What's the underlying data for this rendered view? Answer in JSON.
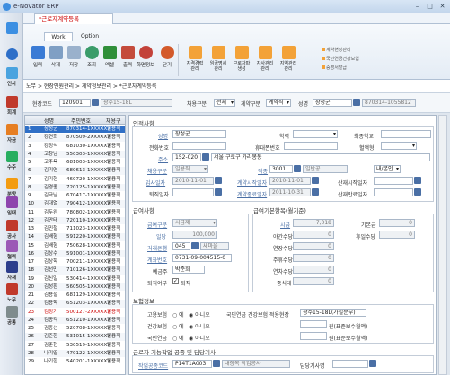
{
  "app": {
    "title": "e-Novator ERP"
  },
  "leftnav": [
    {
      "label": "",
      "name": "home"
    },
    {
      "label": "",
      "name": "favorite"
    },
    {
      "label": "인사",
      "name": "hr"
    },
    {
      "label": "회계",
      "name": "accounting"
    },
    {
      "label": "자금",
      "name": "fund"
    },
    {
      "label": "수주",
      "name": "order"
    },
    {
      "label": "분양",
      "name": "sale"
    },
    {
      "label": "임대",
      "name": "lease"
    },
    {
      "label": "공사",
      "name": "construction"
    },
    {
      "label": "협력",
      "name": "partner"
    },
    {
      "label": "자재",
      "name": "material"
    },
    {
      "label": "노무",
      "name": "labor"
    },
    {
      "label": "공통",
      "name": "common"
    }
  ],
  "doc_tab": "*근로자계약등록",
  "ribbon": {
    "tabs": [
      "Work",
      "Option"
    ],
    "buttons": [
      {
        "label": "입력",
        "color": "#3a7bd5"
      },
      {
        "label": "삭제",
        "color": "#7f9fc4"
      },
      {
        "label": "저장",
        "color": "#9ab1cc"
      },
      {
        "label": "조회",
        "color": "#3a9c6a"
      },
      {
        "label": "엑셀",
        "color": "#2f8f3a"
      },
      {
        "label": "출력",
        "color": "#c44b3c"
      },
      {
        "label": "화면정보",
        "color": "#c3423a"
      },
      {
        "label": "닫기",
        "color": "#d35a2b"
      }
    ],
    "buttons2": [
      [
        "자격경력",
        "관리"
      ],
      [
        "임금명세",
        "관리"
      ],
      [
        "근로자파",
        "생성"
      ],
      [
        "자사관리",
        "관리"
      ],
      [
        "지역관리",
        "관리"
      ]
    ],
    "links": [
      "계약현장관리",
      "국민연금건강보험",
      "증명서발급"
    ]
  },
  "breadcrumb": "노무 > 현장인원관리 > 계약정보관리 > *근로자계약등록",
  "search": {
    "site_label": "현장코드",
    "site_code": "120901",
    "site_name": "광주15-18L",
    "emp_type_label": "채용구분",
    "emp_type": "전체",
    "contract_label": "계약구분",
    "contract": "계약직",
    "name_label": "성명",
    "name": "장성군",
    "reg": "870314-1055812"
  },
  "grid": {
    "headers": [
      "성명",
      "주민번호",
      "채용구"
    ],
    "rows": [
      {
        "no": "1",
        "name": "장성군",
        "id": "870314-1XXXXXX",
        "type": "일용직",
        "sel": true
      },
      {
        "no": "2",
        "name": "강연희",
        "id": "870509-2XXXXXX",
        "type": "일용직"
      },
      {
        "no": "3",
        "name": "강정식",
        "id": "681030-1XXXXXX",
        "type": "일용직"
      },
      {
        "no": "4",
        "name": "고창남",
        "id": "550303-1XXXXXX",
        "type": "일용직"
      },
      {
        "no": "5",
        "name": "고주옥",
        "id": "681003-1XXXXXX",
        "type": "일용직"
      },
      {
        "no": "6",
        "name": "김기연",
        "id": "680613-1XXXXXX",
        "type": "일용직"
      },
      {
        "no": "7",
        "name": "김기현",
        "id": "460720-1XXXXXX",
        "type": "일용직"
      },
      {
        "no": "8",
        "name": "김경종",
        "id": "720125-1XXXXXX",
        "type": "일용직"
      },
      {
        "no": "9",
        "name": "김극남",
        "id": "670417-1XXXXXX",
        "type": "일용직"
      },
      {
        "no": "10",
        "name": "김대열",
        "id": "790412-1XXXXXX",
        "type": "일용직"
      },
      {
        "no": "11",
        "name": "김두완",
        "id": "780802-1XXXXXX",
        "type": "일용직"
      },
      {
        "no": "12",
        "name": "김만태",
        "id": "720110-1XXXXXX",
        "type": "일용직"
      },
      {
        "no": "13",
        "name": "김민철",
        "id": "711023-1XXXXXX",
        "type": "일용직"
      },
      {
        "no": "14",
        "name": "김배형",
        "id": "591220-1XXXXXX",
        "type": "일용직"
      },
      {
        "no": "15",
        "name": "김배형",
        "id": "750628-1XXXXXX",
        "type": "일용직"
      },
      {
        "no": "16",
        "name": "김상수",
        "id": "591001-1XXXXXX",
        "type": "일용직"
      },
      {
        "no": "17",
        "name": "김상학",
        "id": "700211-1XXXXXX",
        "type": "일용직"
      },
      {
        "no": "18",
        "name": "김선민",
        "id": "710126-1XXXXXX",
        "type": "일용직"
      },
      {
        "no": "19",
        "name": "김신일",
        "id": "530414-1XXXXXX",
        "type": "일용직"
      },
      {
        "no": "20",
        "name": "김성환",
        "id": "560505-1XXXXXX",
        "type": "일용직"
      },
      {
        "no": "21",
        "name": "김용철",
        "id": "681129-1XXXXXX",
        "type": "일용직"
      },
      {
        "no": "22",
        "name": "김용학",
        "id": "651203-1XXXXXX",
        "type": "일용직"
      },
      {
        "no": "23",
        "name": "김정기",
        "id": "500127-2XXXXXX",
        "type": "일용직",
        "red": true
      },
      {
        "no": "24",
        "name": "김종각",
        "id": "651210-1XXXXXX",
        "type": "일용직"
      },
      {
        "no": "25",
        "name": "김종선",
        "id": "520708-1XXXXXX",
        "type": "일용직"
      },
      {
        "no": "26",
        "name": "김준한",
        "id": "531015-1XXXXXX",
        "type": "일용직"
      },
      {
        "no": "27",
        "name": "김준현",
        "id": "530519-1XXXXXX",
        "type": "일용직"
      },
      {
        "no": "28",
        "name": "나기엽",
        "id": "470122-1XXXXXX",
        "type": "일용직"
      },
      {
        "no": "29",
        "name": "나기한",
        "id": "540201-1XXXXXX",
        "type": "일용직"
      }
    ]
  },
  "form": {
    "sec_person": "인적사항",
    "name_label": "성명",
    "name": "장성군",
    "edu_label": "학력",
    "school_label": "최종학교",
    "phone_label": "전화번호",
    "mobile_label": "휴대폰번호",
    "blood_label": "혈액형",
    "addr_label": "주소",
    "zip": "152-020",
    "addr": "서울 구로구 가리봉동",
    "emp_type_label": "채용구분",
    "emp_type": "일용직",
    "job_label": "직종",
    "job_code": "3001",
    "job_name": "일반공",
    "job_sel": "내/본인",
    "hire_label": "입사일자",
    "hire": "2010-11-01",
    "start_label": "계약시작일자",
    "start": "2010-11-01",
    "insure_start_label": "산재시작일자",
    "retire_label": "퇴직일자",
    "end_label": "계약종료일자",
    "end": "2011-10-31",
    "insure_end_label": "산재만료일자",
    "sec_pay": "급여사항",
    "pay_type_label": "급여구분",
    "pay_type": "시급제",
    "daily_label": "일당",
    "daily": "100,000",
    "bank_label": "거래은행",
    "bank_code": "045",
    "bank_name": "새마을",
    "acct_label": "계좌번호",
    "acct": "0731-09-004515-0",
    "holder_label": "예금주",
    "holder": "박준희",
    "retire_yn_label": "퇴직여부",
    "retire_yn": "퇴직",
    "sec_calc": "급여기본항목(월기준)",
    "hourly_label": "시급",
    "hourly": "7,018",
    "basic_label": "기본급",
    "basic": "0",
    "night_label": "야간수당",
    "night": "0",
    "holiday_label": "휴일수당",
    "holiday": "0",
    "extend_label": "연장수당",
    "extend": "0",
    "weekly_label": "주휴수당",
    "weekly": "0",
    "annual_label": "연차수당",
    "annual": "0",
    "other_label": "중식대",
    "other": "0",
    "sec_ins": "보험정보",
    "emp_ins_label": "고용보험",
    "yes": "예",
    "no": "아니오",
    "ins_site_label": "국민연금 건강보험 적용현장",
    "ins_site": "광주15-18L(가설분부)",
    "health_label": "건강보험",
    "health_note": "원(표준보수월액)",
    "pension_label": "국민연금",
    "pension_note": "원(표준보수월액)",
    "sec_mgr": "근로자 기능작업 공종 및 담당기사",
    "work_label": "작업공종코드",
    "work_code": "P14T1A003",
    "work_name": "내장목 작업공사",
    "mgr_label": "담당기사명"
  }
}
